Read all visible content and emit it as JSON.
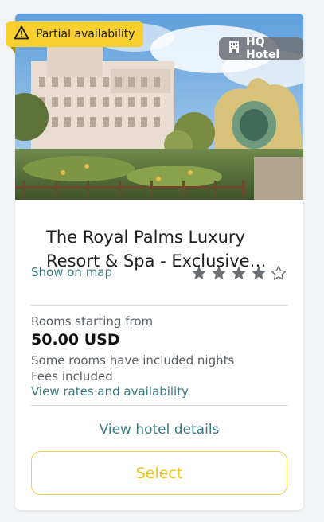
{
  "badges": {
    "availability": "Partial availability",
    "hotel_type": "HQ Hotel"
  },
  "hotel": {
    "title_line1": "The Royal Palms Luxury",
    "title_line2": "Resort & Spa - Exclusive…",
    "map_link": "Show on map",
    "star_rating": 4,
    "star_max": 5
  },
  "pricing": {
    "starting_label": "Rooms starting from",
    "price": "50.00 USD",
    "nights_note": "Some rooms have included nights",
    "fees_note": "Fees included",
    "rates_link": "View rates and availability"
  },
  "actions": {
    "details_link": "View hotel details",
    "select_button": "Select"
  },
  "colors": {
    "accent_yellow": "#f8cf2c",
    "link_teal": "#3a7a80",
    "star_gray": "#6b6f75"
  }
}
